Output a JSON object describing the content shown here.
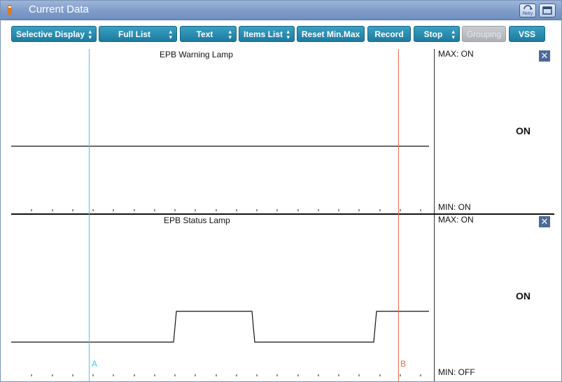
{
  "window": {
    "title": "Current Data",
    "retry_icon": "retry-icon",
    "maximize_icon": "maximize-icon"
  },
  "toolbar": {
    "buttons": [
      {
        "label": "Selective Display",
        "dropdown": true
      },
      {
        "label": "Full List",
        "dropdown": true
      },
      {
        "label": "Text",
        "dropdown": true
      },
      {
        "label": "Items List",
        "dropdown": true
      },
      {
        "label": "Reset Min.Max",
        "dropdown": false
      },
      {
        "label": "Record",
        "dropdown": false
      },
      {
        "label": "Stop",
        "dropdown": true
      },
      {
        "label": "Grouping",
        "dropdown": false,
        "disabled": true
      },
      {
        "label": "VSS",
        "dropdown": false
      }
    ]
  },
  "panels": [
    {
      "title": "EPB Warning Lamp",
      "max_label": "MAX: ON",
      "min_label": "MIN: ON",
      "current_value": "ON"
    },
    {
      "title": "EPB Status Lamp",
      "max_label": "MAX: ON",
      "min_label": "MIN: OFF",
      "current_value": "ON"
    }
  ],
  "cursors": {
    "a_label": "A",
    "b_label": "B",
    "a_color": "#38d0de",
    "b_color": "#e8694a"
  },
  "colors": {
    "titlebar": "#7e9cc9",
    "button": "#2a8ab0",
    "trace": "#111111"
  }
}
